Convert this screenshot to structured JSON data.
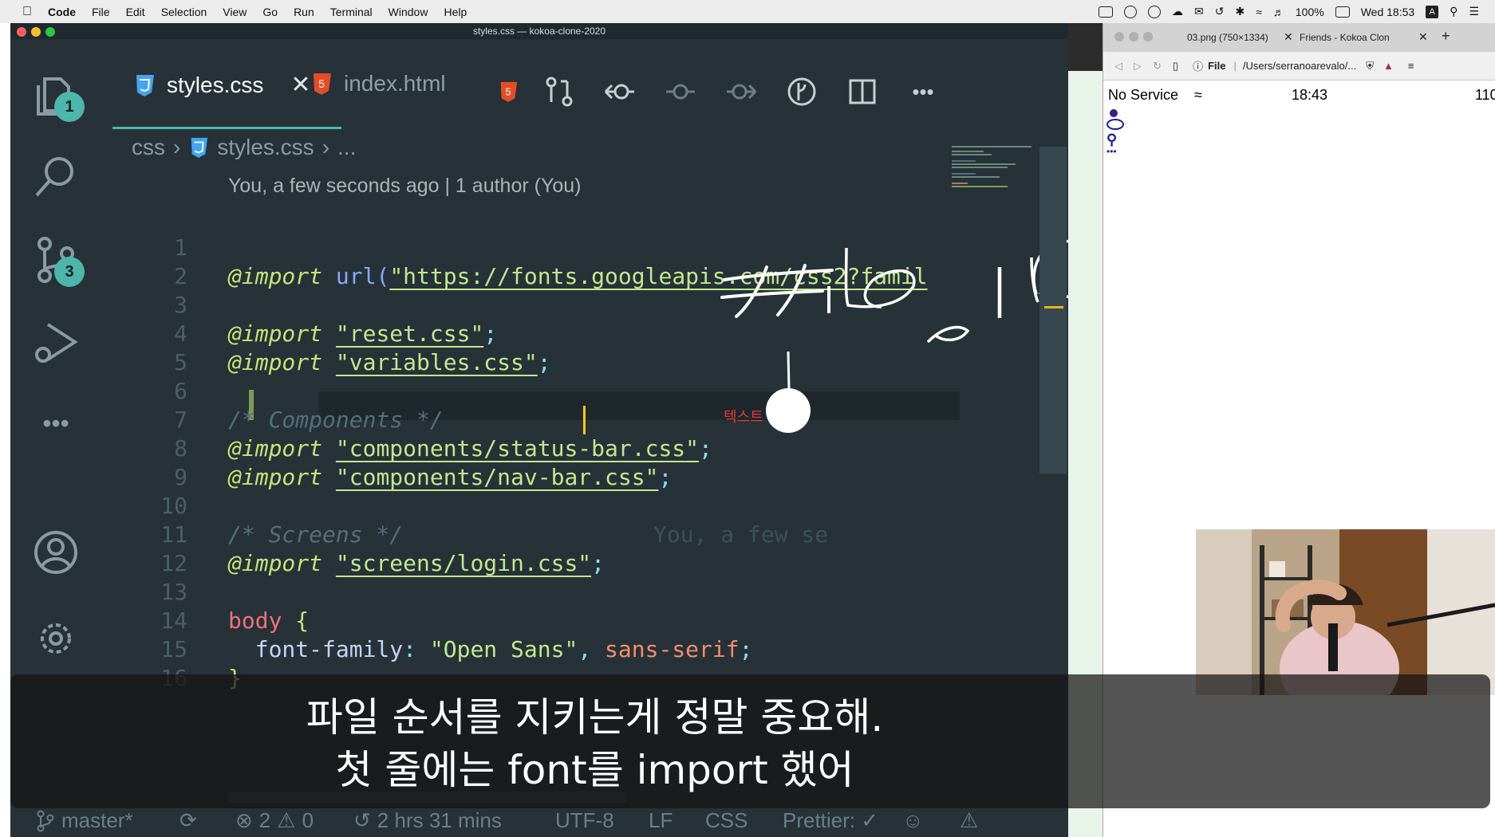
{
  "menubar": {
    "app": "Code",
    "items": [
      "File",
      "Edit",
      "Selection",
      "View",
      "Go",
      "Run",
      "Terminal",
      "Window",
      "Help"
    ],
    "battery": "100%",
    "clock": "Wed 18:53",
    "input_source": "A"
  },
  "vscode": {
    "window_title": "styles.css — kokoa-clone-2020",
    "badges": {
      "explorer": "1",
      "source_control": "3"
    },
    "tabs": [
      {
        "label": "styles.css",
        "active": true
      },
      {
        "label": "index.html",
        "active": false
      }
    ],
    "breadcrumb": {
      "folder": "css",
      "file": "styles.css",
      "more": "..."
    },
    "blame_header": "You, a few seconds ago | 1 author (You)",
    "code_lines": [
      {
        "n": "1",
        "text": "@import url(\"https://fonts.googleapis.com/css2?famil"
      },
      {
        "n": "2",
        "text": ""
      },
      {
        "n": "3",
        "text": "@import \"reset.css\";"
      },
      {
        "n": "4",
        "text": "@import \"variables.css\";"
      },
      {
        "n": "5",
        "text": ""
      },
      {
        "n": "6",
        "text": "/* Components */"
      },
      {
        "n": "7",
        "text": "@import \"components/status-bar.css\";"
      },
      {
        "n": "8",
        "text": "@import \"components/nav-bar.css\";"
      },
      {
        "n": "9",
        "text": ""
      },
      {
        "n": "10",
        "text": "/* Screens */"
      },
      {
        "n": "11",
        "text": "@import \"screens/login.css\";"
      },
      {
        "n": "12",
        "text": ""
      },
      {
        "n": "13",
        "text": "body {"
      },
      {
        "n": "14",
        "text": "  font-family: \"Open Sans\", sans-serif;"
      },
      {
        "n": "15",
        "text": "}"
      },
      {
        "n": "16",
        "text": ""
      }
    ],
    "inline_blame": "You, a few se",
    "annotation_small": "텍스트",
    "status": {
      "branch": "master*",
      "errors": "2",
      "warnings": "0",
      "time": "2 hrs 31 mins",
      "encoding": "UTF-8",
      "eol": "LF",
      "language": "CSS",
      "formatter": "Prettier: ✓"
    },
    "colors": {
      "bg": "#263238",
      "accent": "#4db6ac",
      "html_icon": "#e44d26",
      "css_icon": "#42a5f5"
    }
  },
  "browser": {
    "tabs": [
      {
        "label": "03.png (750×1334)"
      },
      {
        "label": "Friends - Kokoa Clon"
      }
    ],
    "address_prefix": "File",
    "address": "/Users/serranoarevalo/...",
    "phone_status": {
      "carrier": "No Service",
      "time": "18:43",
      "battery": "110"
    }
  },
  "subtitle": {
    "line1": "파일 순서를 지키는게 정말 중요해.",
    "line2": "첫 줄에는 font를 import 했어"
  }
}
